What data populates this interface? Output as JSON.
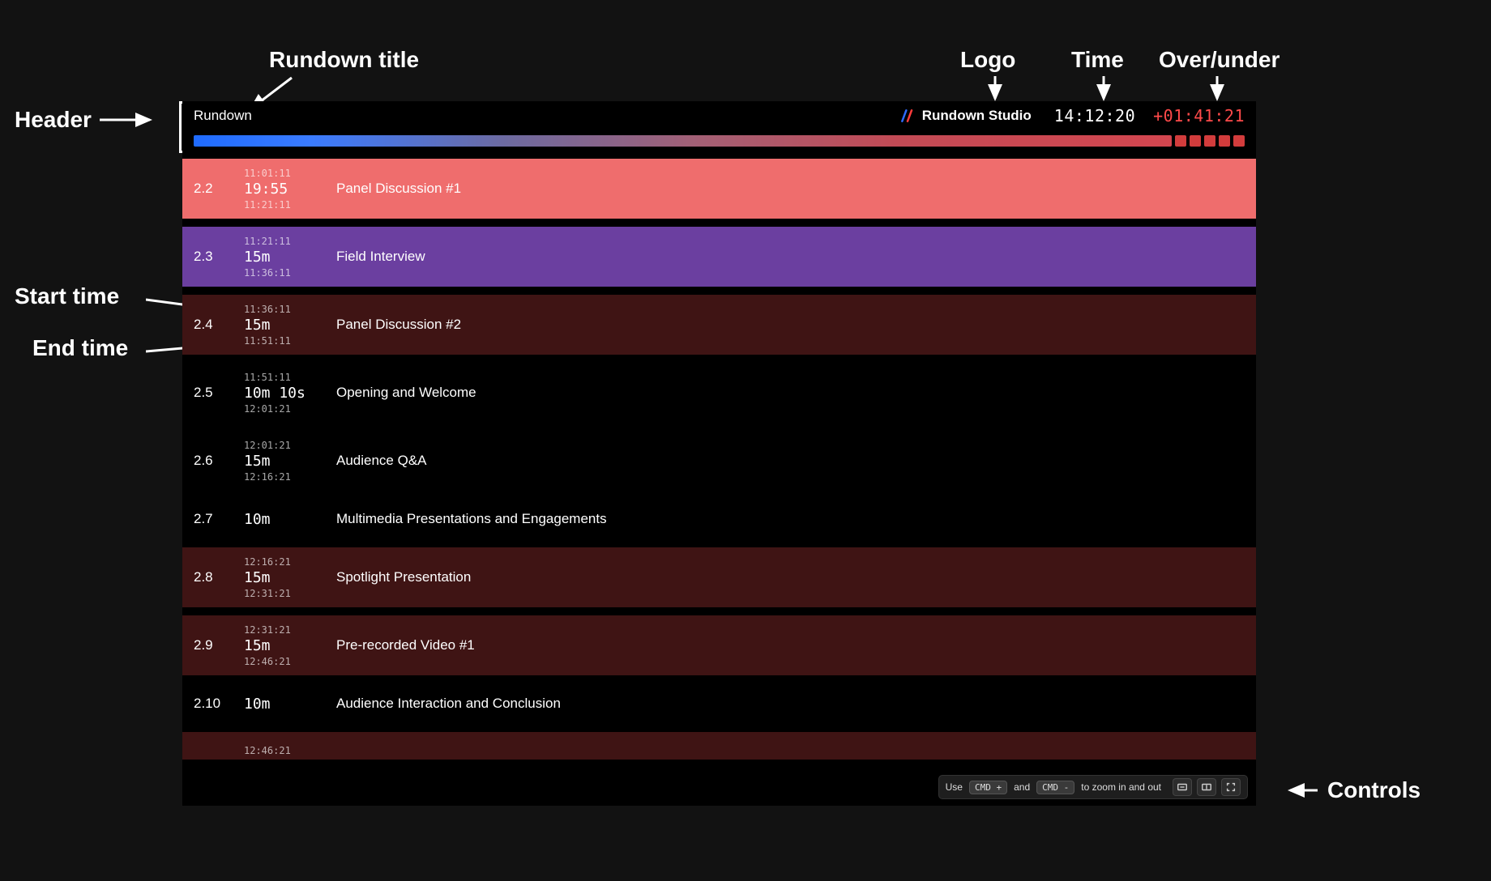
{
  "annotations": {
    "header": "Header",
    "rundown_title": "Rundown title",
    "logo": "Logo",
    "time": "Time",
    "over_under": "Over/under",
    "start_time": "Start time",
    "end_time": "End time",
    "controls": "Controls"
  },
  "header": {
    "title": "Rundown",
    "product_name": "Rundown Studio",
    "clock": "14:12:20",
    "over_under": "+01:41:21"
  },
  "rows": [
    {
      "num": "2.2",
      "start": "11:01:11",
      "duration": "19:55",
      "end": "11:21:11",
      "title": "Panel Discussion #1",
      "bg": "bg-red-bright",
      "compact": false
    },
    {
      "num": "2.3",
      "start": "11:21:11",
      "duration": "15m",
      "end": "11:36:11",
      "title": "Field Interview",
      "bg": "bg-purple",
      "compact": false
    },
    {
      "num": "2.4",
      "start": "11:36:11",
      "duration": "15m",
      "end": "11:51:11",
      "title": "Panel Discussion #2",
      "bg": "bg-maroon",
      "compact": false
    },
    {
      "num": "2.5",
      "start": "11:51:11",
      "duration": "10m 10s",
      "end": "12:01:21",
      "title": "Opening and Welcome",
      "bg": "bg-black",
      "compact": false
    },
    {
      "num": "2.6",
      "start": "12:01:21",
      "duration": "15m",
      "end": "12:16:21",
      "title": "Audience Q&A",
      "bg": "bg-black",
      "compact": false
    },
    {
      "num": "2.7",
      "start": "",
      "duration": "10m",
      "end": "",
      "title": "Multimedia Presentations and Engagements",
      "bg": "bg-black",
      "compact": true
    },
    {
      "num": "2.8",
      "start": "12:16:21",
      "duration": "15m",
      "end": "12:31:21",
      "title": "Spotlight Presentation",
      "bg": "bg-maroon",
      "compact": false
    },
    {
      "num": "2.9",
      "start": "12:31:21",
      "duration": "15m",
      "end": "12:46:21",
      "title": "Pre-recorded Video #1",
      "bg": "bg-maroon",
      "compact": false
    },
    {
      "num": "2.10",
      "start": "",
      "duration": "10m",
      "end": "",
      "title": "Audience Interaction and Conclusion",
      "bg": "bg-black",
      "compact": true
    }
  ],
  "partial_row_start": "12:46:21",
  "controls": {
    "use": "Use",
    "kbd1": "CMD +",
    "and": "and",
    "kbd2": "CMD -",
    "rest": "to zoom in and out"
  }
}
